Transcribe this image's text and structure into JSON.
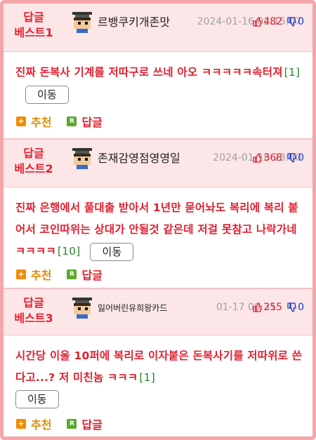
{
  "comments": [
    {
      "badge_line1": "답글",
      "badge_line2": "베스트1",
      "nickname": "르뱅쿠키개존맛",
      "date": "2024-01-16 02:15:07",
      "likes": "482",
      "dislikes": "0",
      "text": "진짜 돈복사 기계를 저따구로 쓰네 아오 ㅋㅋㅋㅋㅋ속터져",
      "reply_count": "[1]",
      "move_label": "이동",
      "recommend_label": "추천",
      "reply_label": "답글"
    },
    {
      "badge_line1": "답글",
      "badge_line2": "베스트2",
      "nickname": "존재감영점영영일",
      "date": "2024-01-16 23:30",
      "likes": "368",
      "dislikes": "0",
      "text": "진짜 은행에서 풀대출 받아서 1년만 묻어놔도 복리에 복리 붙어서 코인따위는 상대가 안될것 같은데 저걸 못참고 나락가네 ㅋㅋㅋㅋ",
      "reply_count": "[10]",
      "move_label": "이동",
      "recommend_label": "추천",
      "reply_label": "답글"
    },
    {
      "badge_line1": "답글",
      "badge_line2": "베스트3",
      "nickname": "잃어버린유희왕카드",
      "date": "01-17 00:31",
      "likes": "255",
      "dislikes": "0",
      "text": "시간당 이울 10퍼에 복리로 이자붙은 돈복사기를 저따위로 쓴다고...? 저 미친놈 ㅋㅋㅋ",
      "reply_count": "[1]",
      "move_label": "이동",
      "recommend_label": "추천",
      "reply_label": "답글"
    }
  ],
  "colors": {
    "accent_red": "#e02030",
    "header_bg": "#fde6e8",
    "frame_border": "#f4a6ab",
    "recommend": "#e08a00",
    "reply_count": "#2a8a2a",
    "dislike_blue": "#1a35c9"
  },
  "icons": {
    "avatar": "pixel-avatar-icon",
    "like": "thumbs-up-icon",
    "dislike": "thumbs-down-icon",
    "recommend": "plus-square-icon",
    "reply": "r-square-icon"
  }
}
